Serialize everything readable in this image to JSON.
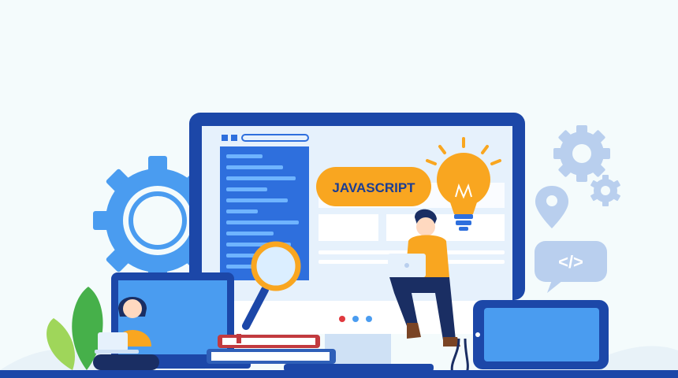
{
  "banner": {
    "badge_text": "JAVASCRIPT",
    "code_tag": "</>"
  },
  "colors": {
    "background": "#f4fbfc",
    "monitor_frame": "#1c47a8",
    "screen": "#e6f1fc",
    "code_panel": "#2e6fdd",
    "badge": "#f9a620",
    "badge_text": "#1b3d93",
    "gear_blue": "#4a9cf0",
    "gear_light": "#b9cfee",
    "bulb": "#f9a620",
    "leaf_green": "#46b04a",
    "leaf_light": "#9fd65a",
    "book_red": "#c23a3f",
    "book_blue": "#2f5fb8"
  },
  "icons": [
    "gear-icon",
    "lightbulb-icon",
    "magnifier-icon",
    "location-pin-icon",
    "code-bubble-icon",
    "plant-icon"
  ]
}
